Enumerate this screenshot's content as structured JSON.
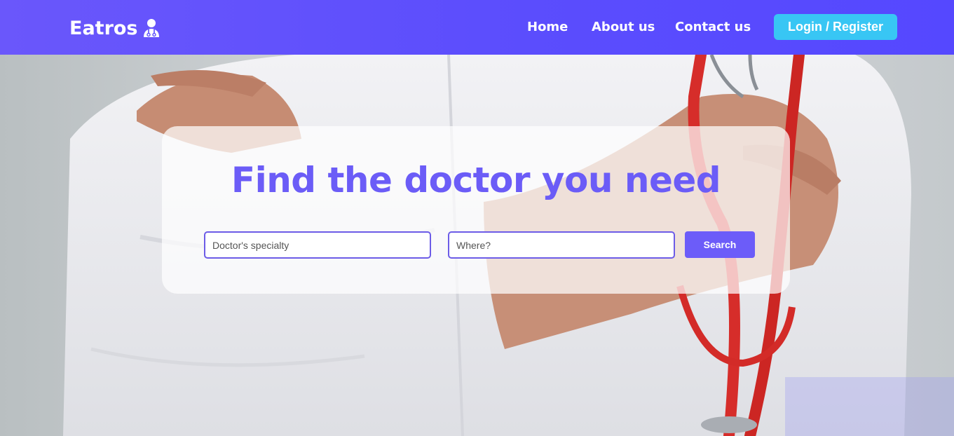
{
  "header": {
    "brand": "Eatros",
    "brand_icon": "doctor-icon",
    "nav": [
      {
        "label": "Home"
      },
      {
        "label": "About us"
      },
      {
        "label": "Contact us"
      }
    ],
    "login_label": "Login / Register"
  },
  "hero": {
    "title": "Find the doctor you need",
    "specialty_placeholder": "Doctor's specialty",
    "where_placeholder": "Where?",
    "search_label": "Search"
  },
  "colors": {
    "header": "#5b4dfd",
    "accent": "#6c5ce7",
    "login_button": "#38c6f4"
  }
}
